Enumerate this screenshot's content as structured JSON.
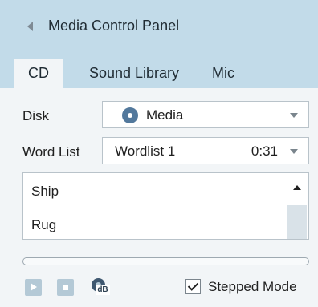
{
  "panel": {
    "title": "Media Control Panel",
    "icons": {
      "collapse": "chevron-left-icon"
    }
  },
  "tabs": {
    "items": [
      {
        "label": "CD",
        "selected": true
      },
      {
        "label": "Sound Library",
        "selected": false
      },
      {
        "label": "Mic",
        "selected": false
      }
    ]
  },
  "form": {
    "disk_label": "Disk",
    "disk_value": "Media",
    "word_list_label": "Word List",
    "word_list_value": "Wordlist 1",
    "word_list_time": "0:31"
  },
  "words": {
    "items": [
      "Ship",
      "Rug"
    ]
  },
  "progress": {
    "value": 0
  },
  "controls": {
    "db_label": "dB",
    "stepped_mode_label": "Stepped Mode",
    "stepped_mode_checked": true
  },
  "colors": {
    "header": "#c2dbe9",
    "panel": "#f2f5f7",
    "accent": "#52789c",
    "button": "#b4c9d6"
  }
}
